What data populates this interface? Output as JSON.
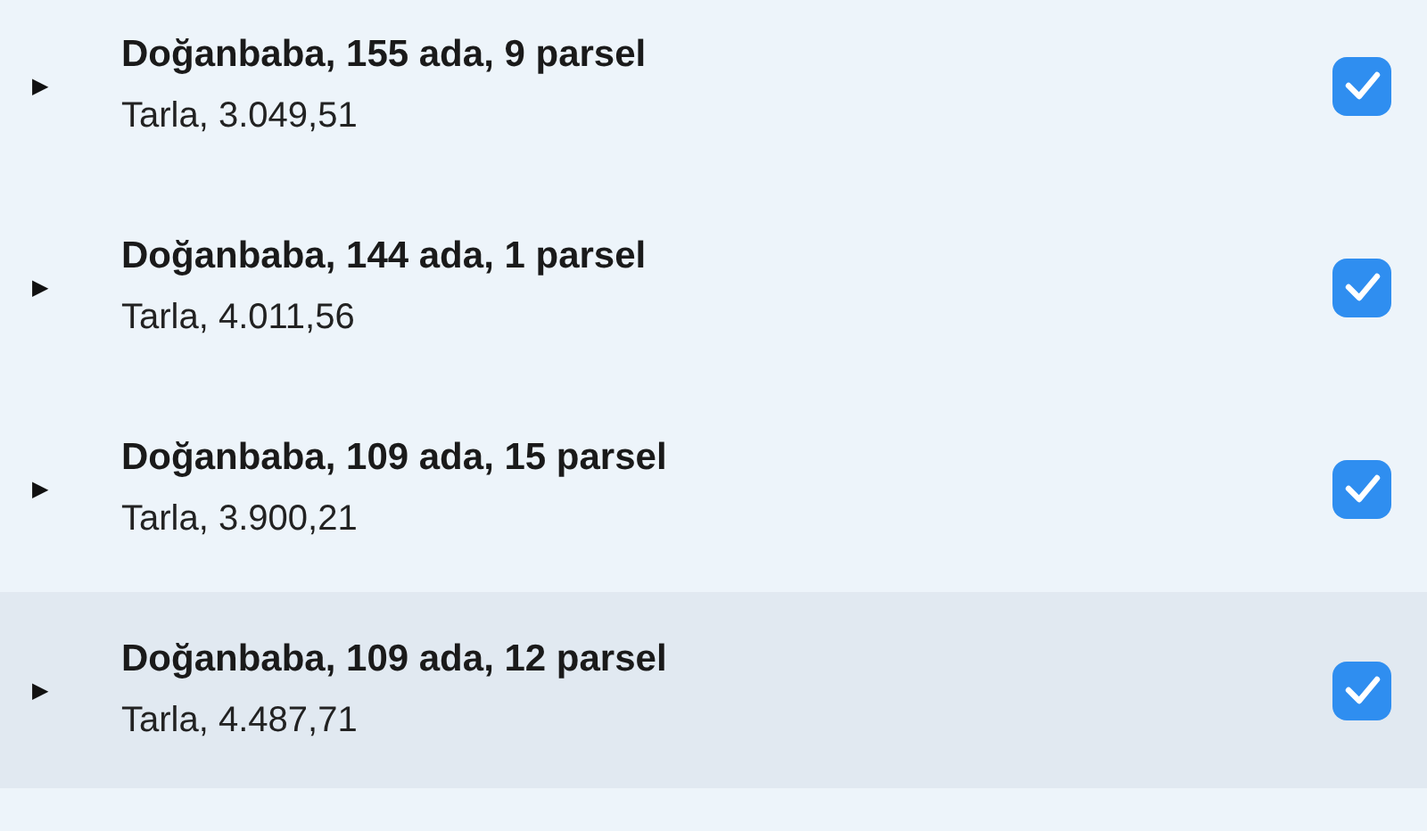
{
  "parcels": [
    {
      "title": "Doğanbaba, 155 ada, 9 parsel",
      "subtitle": "Tarla, 3.049,51",
      "expander": "▶",
      "checked": true,
      "selected": false
    },
    {
      "title": "Doğanbaba, 144 ada, 1 parsel",
      "subtitle": "Tarla, 4.011,56",
      "expander": "▶",
      "checked": true,
      "selected": false
    },
    {
      "title": "Doğanbaba, 109 ada, 15 parsel",
      "subtitle": "Tarla, 3.900,21",
      "expander": "▶",
      "checked": true,
      "selected": false
    },
    {
      "title": "Doğanbaba, 109 ada, 12 parsel",
      "subtitle": "Tarla, 4.487,71",
      "expander": "▶",
      "checked": true,
      "selected": true
    }
  ]
}
